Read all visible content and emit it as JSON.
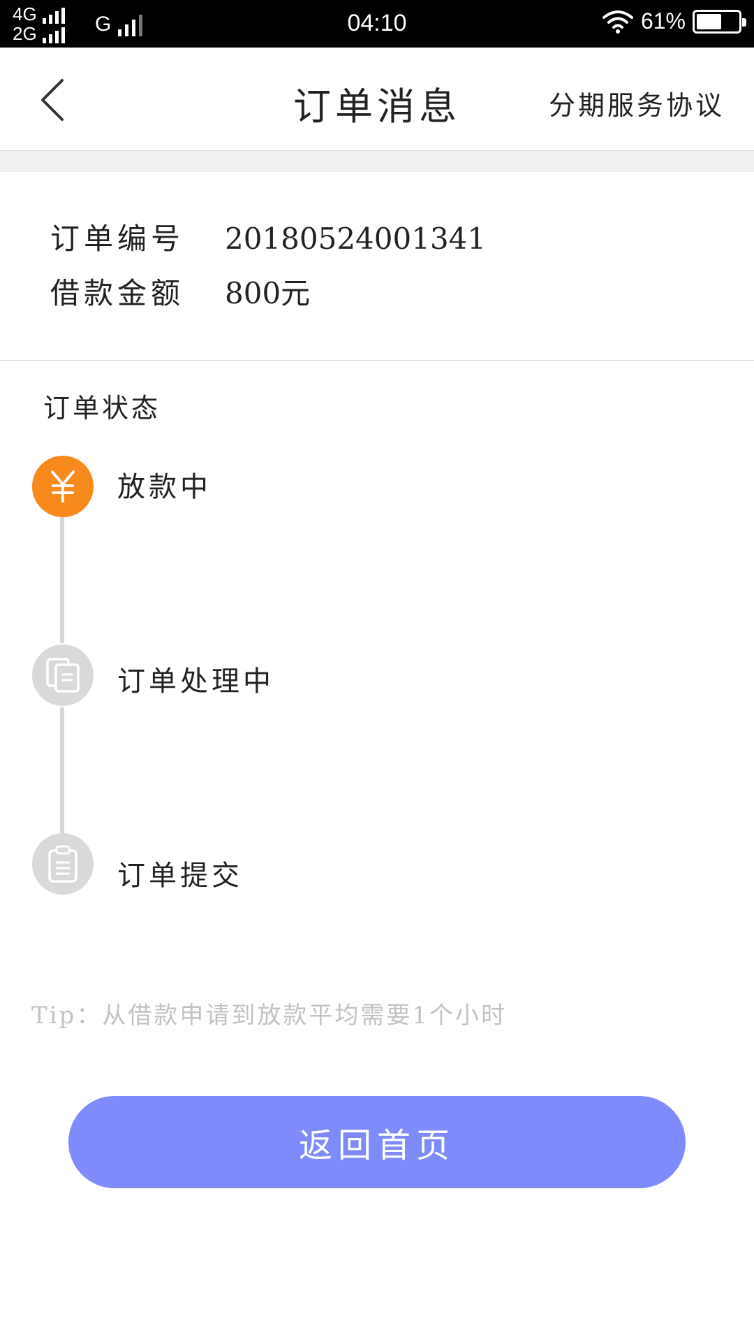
{
  "status_bar": {
    "net1": "4G",
    "net2": "2G",
    "net3": "G",
    "time": "04:10",
    "battery_text": "61%",
    "battery_level": 0.61
  },
  "header": {
    "title": "订单消息",
    "link": "分期服务协议",
    "back_icon": "chevron-left-icon"
  },
  "order": {
    "number_label": "订单编号",
    "number_value": "20180524001341",
    "amount_label": "借款金额",
    "amount_value": "800元"
  },
  "status": {
    "title": "订单状态",
    "steps": [
      {
        "label": "放款中",
        "icon": "yuan-icon",
        "active": true
      },
      {
        "label": "订单处理中",
        "icon": "documents-icon",
        "active": false
      },
      {
        "label": "订单提交",
        "icon": "clipboard-icon",
        "active": false
      }
    ]
  },
  "tip": "Tip：从借款申请到放款平均需要1个小时",
  "home_button": "返回首页",
  "colors": {
    "accent": "#f7891d",
    "button": "#7f8bfa",
    "inactive_icon": "#d9d9d9",
    "tip_text": "#c2c2c2"
  }
}
